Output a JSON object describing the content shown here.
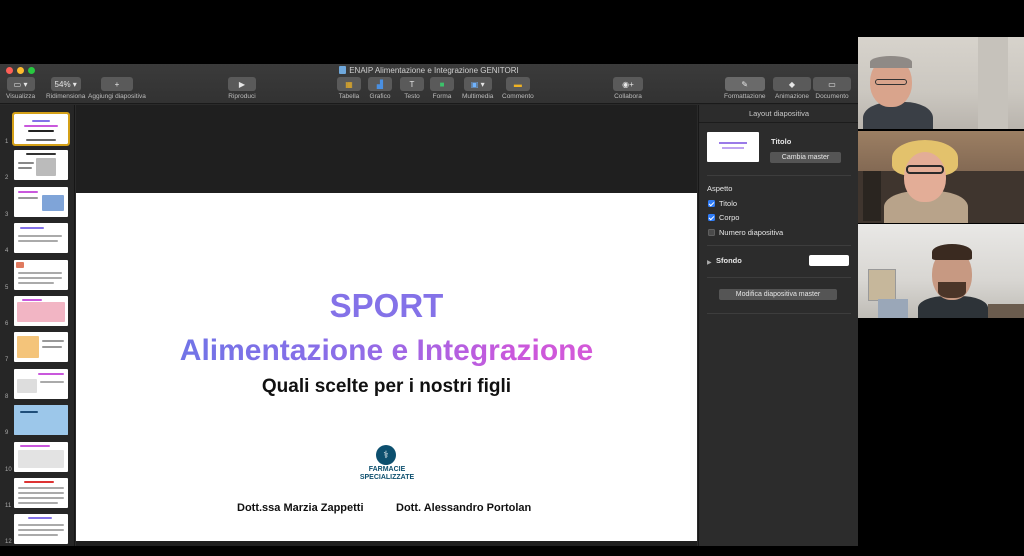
{
  "window": {
    "title": "ENAIP Alimentazione e Integrazione GENITORI"
  },
  "toolbar": {
    "zoom_value": "54%",
    "view_label": "Visualizza",
    "zoom_label": "Ridimensiona",
    "add_slide_label": "Aggiungi diapositiva",
    "play_label": "Riproduci",
    "table_label": "Tabella",
    "chart_label": "Grafico",
    "text_label": "Testo",
    "shape_label": "Forma",
    "media_label": "Multimedia",
    "comment_label": "Commento",
    "collab_label": "Collabora",
    "format_label": "Formattazione",
    "animate_label": "Animazione",
    "document_label": "Documento"
  },
  "navigator": {
    "slide_numbers": [
      "1",
      "2",
      "3",
      "4",
      "5",
      "6",
      "7",
      "8",
      "9",
      "10",
      "11",
      "12"
    ],
    "selected_index": 0
  },
  "slide": {
    "title_line1": "SPORT",
    "title_line2": "Alimentazione e Integrazione",
    "subtitle": "Quali scelte per i nostri figli",
    "logo_text_line1": "FARMACIE",
    "logo_text_line2": "SPECIALIZZATE",
    "author1": "Dott.ssa Marzia Zappetti",
    "author2": "Dott. Alessandro Portolan"
  },
  "inspector": {
    "header": "Layout diapositiva",
    "layout_name": "Titolo",
    "change_master_label": "Cambia master",
    "appearance_label": "Aspetto",
    "checkbox_title": "Titolo",
    "checkbox_title_checked": true,
    "checkbox_body": "Corpo",
    "checkbox_body_checked": true,
    "checkbox_number": "Numero diapositiva",
    "checkbox_number_checked": false,
    "background_label": "Sfondo",
    "background_color": "#ffffff",
    "edit_master_label": "Modifica diapositiva master"
  },
  "colors": {
    "selection_outline": "#d4a017",
    "checkbox_blue": "#2f7cf6",
    "title_purple": "#8472e8",
    "gradient_start": "#5f78e6",
    "gradient_end": "#e25ad4",
    "logo_teal": "#0c4f6e"
  }
}
